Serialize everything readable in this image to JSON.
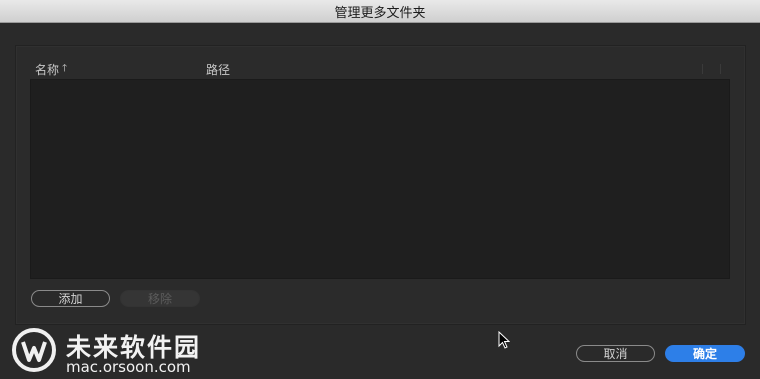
{
  "window": {
    "title": "管理更多文件夹"
  },
  "table": {
    "columns": [
      {
        "label": "名称",
        "sort_icon": "sort-ascending-icon"
      },
      {
        "label": "路径"
      }
    ],
    "rows": []
  },
  "buttons": {
    "add_label": "添加",
    "remove_label": "移除",
    "cancel_label": "取消",
    "ok_label": "确定"
  },
  "watermark": {
    "name": "未来软件园",
    "url": "mac.orsoon.com"
  },
  "colors": {
    "background": "#2a2a2a",
    "list_background": "#1f1f1f",
    "primary_button": "#2d7fe8"
  }
}
